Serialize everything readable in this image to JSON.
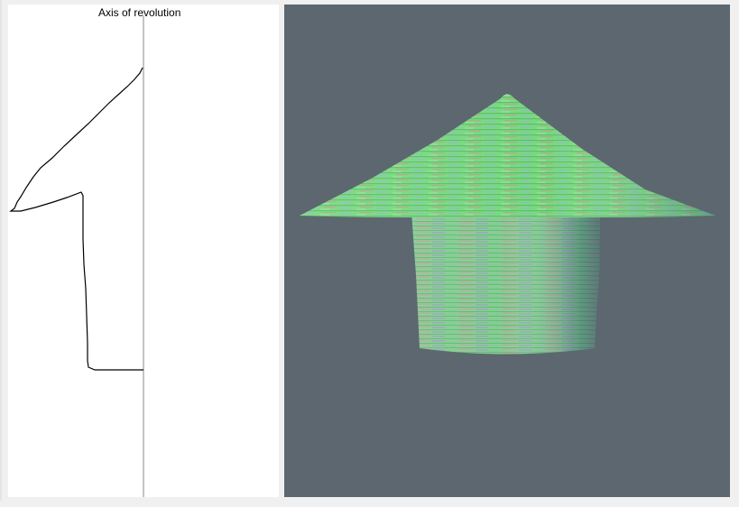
{
  "profile_editor": {
    "axis_label": "Axis of revolution"
  },
  "viewport": {
    "background_color": "#5c6770",
    "model": "surface-of-revolution"
  }
}
